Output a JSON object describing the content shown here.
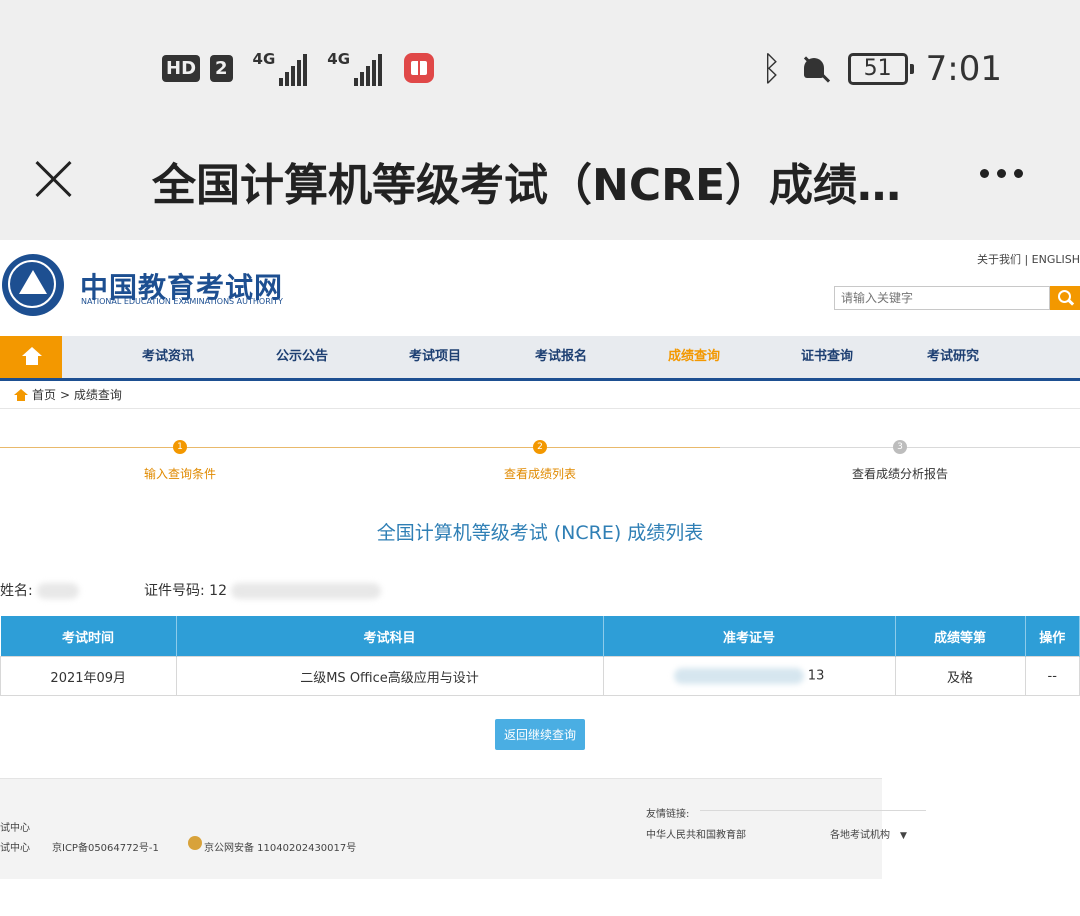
{
  "status_bar": {
    "hd": "HD",
    "sim": "2",
    "net1": "4G",
    "net2": "4G",
    "battery": "51",
    "time": "7:01"
  },
  "browser": {
    "title": "全国计算机等级考试（NCRE）成绩…"
  },
  "site": {
    "name_cn": "中国教育考试网",
    "name_en": "NATIONAL EDUCATION EXAMINATIONS AUTHORITY",
    "top_links": "关于我们 | ENGLISH",
    "search_placeholder": "请输入关键字"
  },
  "nav": {
    "items": [
      "考试资讯",
      "公示公告",
      "考试项目",
      "考试报名",
      "成绩查询",
      "证书查询",
      "考试研究"
    ],
    "active_index": 4
  },
  "breadcrumb": {
    "home": "首页",
    "current": "> 成绩查询"
  },
  "steps": [
    {
      "num": "1",
      "label": "输入查询条件"
    },
    {
      "num": "2",
      "label": "查看成绩列表"
    },
    {
      "num": "3",
      "label": "查看成绩分析报告"
    }
  ],
  "result": {
    "title": "全国计算机等级考试 (NCRE) 成绩列表",
    "name_label": "姓名:",
    "name_visible": "",
    "id_label": "证件号码:",
    "id_visible": "12"
  },
  "table": {
    "headers": [
      "考试时间",
      "考试科目",
      "准考证号",
      "成绩等第",
      "操作"
    ],
    "rows": [
      {
        "time": "2021年09月",
        "subject": "二级MS Office高级应用与设计",
        "ticket": "13",
        "grade": "及格",
        "action": "--"
      }
    ]
  },
  "back_button": "返回继续查询",
  "footer": {
    "line1": "试中心",
    "line2": "试中心",
    "icp": "京ICP备05064772号-1",
    "police": "京公网安备 11040202430017号",
    "friend_links_label": "友情链接:",
    "moe": "中华人民共和国教育部",
    "orgs": "各地考试机构",
    "caret": "▼"
  },
  "colors": {
    "brand_blue": "#1d4f91",
    "accent_orange": "#f39800",
    "table_header": "#2e9ed7",
    "title_blue": "#2f7fb5"
  }
}
